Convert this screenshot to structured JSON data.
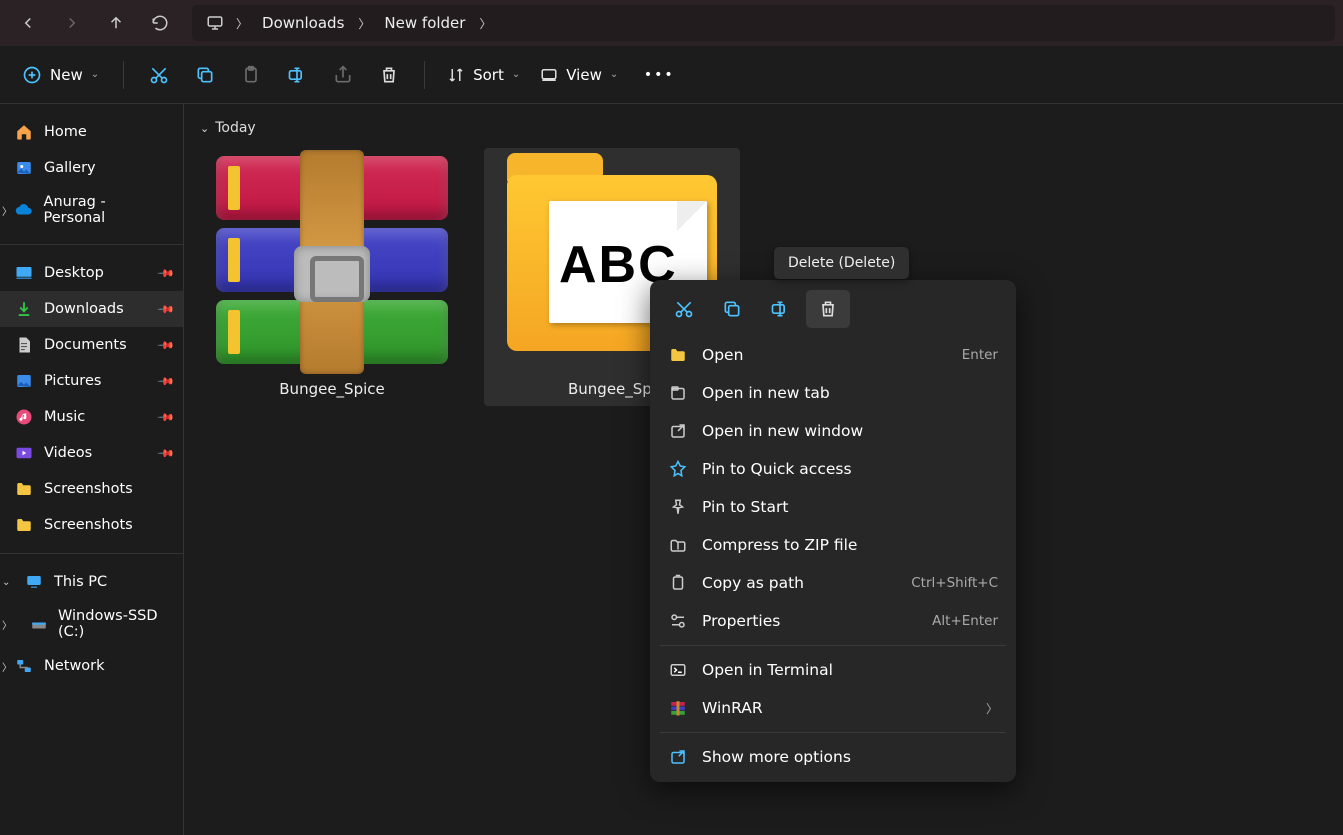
{
  "breadcrumb": {
    "items": [
      "Downloads",
      "New folder"
    ]
  },
  "toolbar": {
    "new_label": "New",
    "sort_label": "Sort",
    "view_label": "View"
  },
  "sidebar": {
    "home": "Home",
    "gallery": "Gallery",
    "onedrive": "Anurag - Personal",
    "items": [
      {
        "label": "Desktop",
        "pin": true
      },
      {
        "label": "Downloads",
        "pin": true,
        "active": true
      },
      {
        "label": "Documents",
        "pin": true
      },
      {
        "label": "Pictures",
        "pin": true
      },
      {
        "label": "Music",
        "pin": true
      },
      {
        "label": "Videos",
        "pin": true
      },
      {
        "label": "Screenshots",
        "pin": false
      },
      {
        "label": "Screenshots",
        "pin": false
      }
    ],
    "thispc": "This PC",
    "drive": "Windows-SSD (C:)",
    "network": "Network"
  },
  "content": {
    "group_label": "Today",
    "files": [
      {
        "name": "Bungee_Spice"
      },
      {
        "name": "Bungee_Spi"
      }
    ]
  },
  "tooltip": "Delete (Delete)",
  "context_menu": {
    "items": [
      {
        "label": "Open",
        "shortcut": "Enter",
        "icon": "open"
      },
      {
        "label": "Open in new tab",
        "icon": "newtab"
      },
      {
        "label": "Open in new window",
        "icon": "newwin"
      },
      {
        "label": "Pin to Quick access",
        "icon": "pin"
      },
      {
        "label": "Pin to Start",
        "icon": "pin"
      },
      {
        "label": "Compress to ZIP file",
        "icon": "zip"
      },
      {
        "label": "Copy as path",
        "shortcut": "Ctrl+Shift+C",
        "icon": "copypath"
      },
      {
        "label": "Properties",
        "shortcut": "Alt+Enter",
        "icon": "props"
      }
    ],
    "terminal": "Open in Terminal",
    "winrar": "WinRAR",
    "more": "Show more options"
  }
}
